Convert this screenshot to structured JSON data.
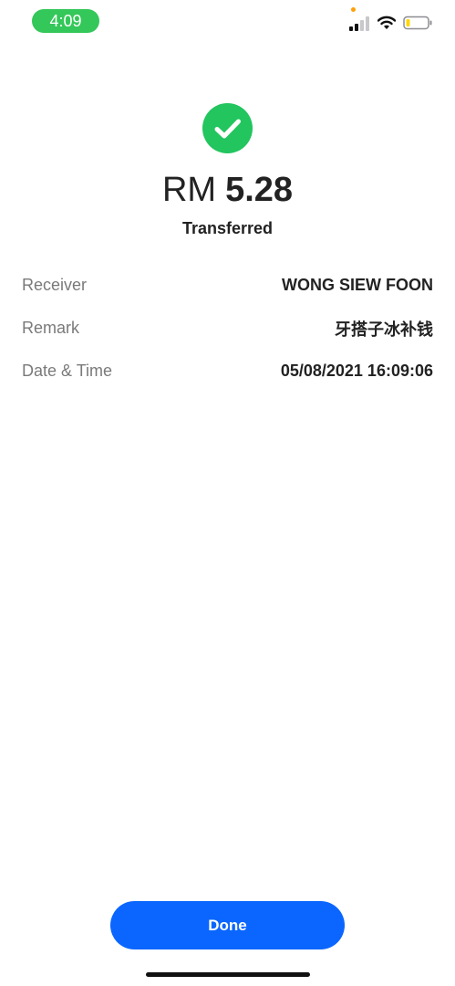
{
  "status_bar": {
    "time": "4:09",
    "colors": {
      "time_pill": "#34c759",
      "privacy_dot": "#ff9f0a",
      "battery_level": "#ffd60a"
    }
  },
  "receipt": {
    "currency": "RM",
    "amount": "5.28",
    "status": "Transferred",
    "details": [
      {
        "label": "Receiver",
        "value": "WONG SIEW FOON"
      },
      {
        "label": "Remark",
        "value": "牙搭子冰补钱"
      },
      {
        "label": "Date & Time",
        "value": "05/08/2021 16:09:06"
      }
    ],
    "colors": {
      "success": "#22c55e",
      "primary_text": "#222222",
      "label_text": "#7a7a7a"
    }
  },
  "actions": {
    "done_label": "Done",
    "done_color": "#0a66ff"
  },
  "icons": {
    "success": "check-circle-icon",
    "signal": "cellular-signal-icon",
    "wifi": "wifi-icon",
    "battery": "battery-icon"
  }
}
